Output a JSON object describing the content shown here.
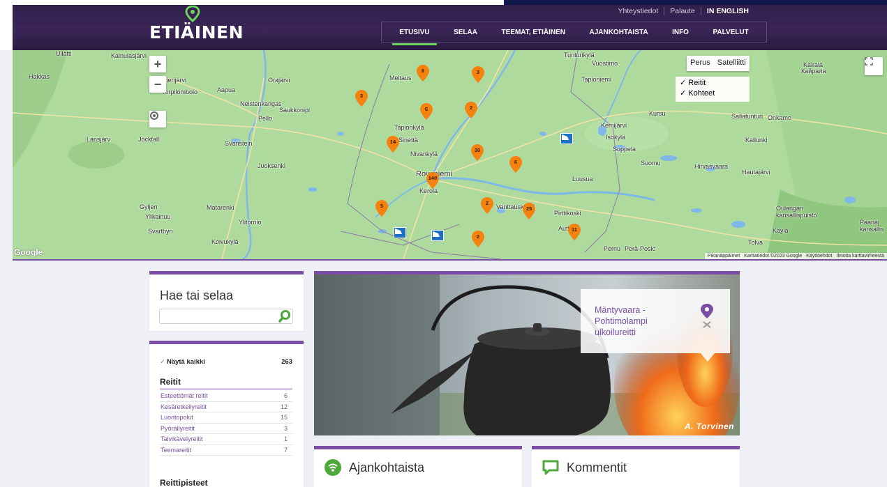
{
  "header": {
    "logo_text": "ETIÄINEN",
    "utility_links": [
      "Yhteystiedot",
      "Palaute",
      "IN ENGLISH"
    ],
    "nav": [
      {
        "label": "ETUSIVU",
        "active": true
      },
      {
        "label": "SELAA",
        "active": false
      },
      {
        "label": "TEEMAT, ETIÄINEN",
        "active": false
      },
      {
        "label": "AJANKOHTAISTA",
        "active": false
      },
      {
        "label": "INFO",
        "active": false
      },
      {
        "label": "PALVELUT",
        "active": false
      }
    ]
  },
  "map": {
    "zoom_in": "+",
    "zoom_out": "−",
    "map_types": [
      "Perus",
      "Satelliitti"
    ],
    "layers": [
      {
        "label": "Reitit",
        "checked": true
      },
      {
        "label": "Kohteet",
        "checked": true
      }
    ],
    "google_label": "Google",
    "attribution": [
      "Pikanäppäimet",
      "Karttatiedot ©2023 Google",
      "Käyttöehdot",
      "Ilmoita karttavirheestä"
    ],
    "places": [
      "Ullatti",
      "Kainulasjärvi",
      "Hakkas",
      "Jierijärvi",
      "Orajärvi",
      "Aapua",
      "Torpilombolo",
      "Meltaus",
      "Tunturikylä",
      "Vuostimo",
      "Tapioniemi",
      "Kairala",
      "Кайрала",
      "Neistenkangas",
      "Saukkonipi",
      "Pello",
      "Kursu",
      "Sallatunturi",
      "Onkamo",
      "Tapionkylä",
      "Kemijärvi",
      "Isokylä",
      "Lansjärv",
      "Jockfall",
      "Svanstein",
      "Sinettä",
      "Nivankylä",
      "Soppela",
      "Kallunki",
      "Juoksenki",
      "Suomu",
      "Hirvasvaara",
      "Hautajärvi",
      "Rovaniemi",
      "Kerola",
      "Luusua",
      "Gyljen",
      "Ylikainuu",
      "Matarenki",
      "Vanttauskoski",
      "Pirttikoski",
      "Oulangan kansallispuisto",
      "Ylitornio",
      "Svartbyn",
      "Koivukylä",
      "Autti",
      "Käylä",
      "Tolva",
      "Pernu",
      "Perä-Posio",
      "Paanaj kansallis"
    ],
    "clusters": [
      "8",
      "3",
      "3",
      "6",
      "2",
      "14",
      "30",
      "6",
      "140",
      "5",
      "2",
      "25",
      "2",
      "11"
    ]
  },
  "search": {
    "title": "Hae tai selaa",
    "placeholder": ""
  },
  "filters": {
    "show_all_label": "Näytä kaikki",
    "show_all_count": "263",
    "routes_title": "Reitit",
    "routes": [
      {
        "label": "Esteettömät reitit",
        "count": "6"
      },
      {
        "label": "Kesäretkeilyreitit",
        "count": "12"
      },
      {
        "label": "Luontopolut",
        "count": "15"
      },
      {
        "label": "Pyöräilyreitit",
        "count": "3"
      },
      {
        "label": "Talvikävelyreitit",
        "count": "1"
      },
      {
        "label": "Teemareitit",
        "count": "7"
      }
    ],
    "points_title": "Reittipisteet"
  },
  "hero": {
    "caption": "Mäntyvaara - Pohtimolampi ulkoilureitti",
    "credit": "A. Torvinen"
  },
  "news": {
    "title": "Ajankohtaista"
  },
  "comments": {
    "title": "Kommentit"
  },
  "colors": {
    "brand": "#3b2657",
    "accent": "#7a4fa3",
    "nav_active": "#6bd35c",
    "marker": "#f5820f",
    "poi": "#1c6fc2"
  }
}
